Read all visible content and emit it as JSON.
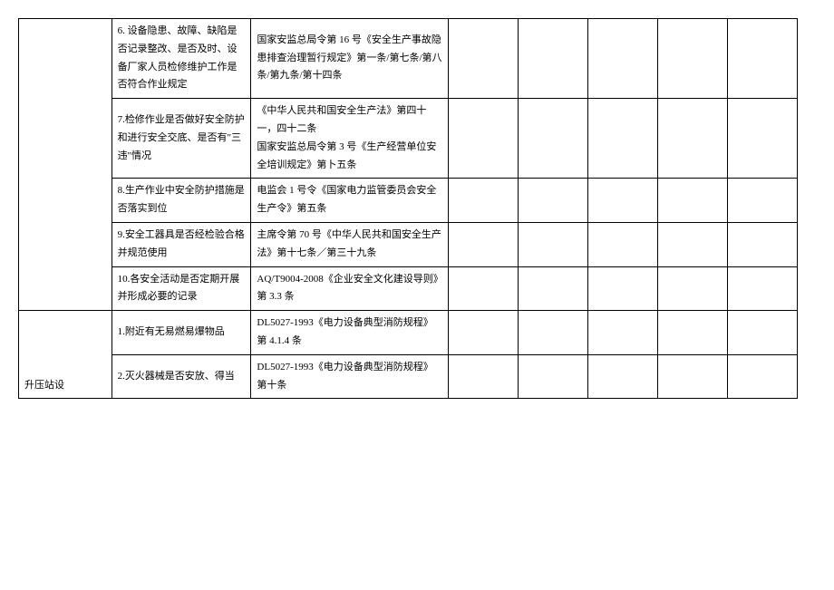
{
  "rows": [
    {
      "col1": "",
      "col2": "6. 设备隐患、故障、缺陷是否记录整改、是否及时、设备厂家人员检修维护工作是否符合作业规定",
      "col3": "国家安监总局令第 16 号《安全生产事故隐患排查治理暂行规定》第一条/第七条/第八条/第九条/第十四条"
    },
    {
      "col1": "",
      "col2": "7.检修作业是否做好安全防护和进行安全交底、是否有\"三违\"情况",
      "col3": "《中华人民共和国安全生产法》第四十一，四十二条\n国家安监总局令第 3 号《生产经营单位安全培训规定》第卜五条"
    },
    {
      "col1": "",
      "col2": "8.生产作业中安全防护措施是否落实到位",
      "col3": "电监会 1 号令《国家电力监管委员会安全生产令》第五条"
    },
    {
      "col1": "",
      "col2": "9.安全工器具是否经检验合格并规范使用",
      "col3": "主席令第 70 号《中华人民共和国安全生产法》第十七条／第三十九条"
    },
    {
      "col1": "",
      "col2": "10.各安全活动是否定期开展并形成必要的记录",
      "col3": "AQ/T9004-2008《企业安全文化建设导则》第 3.3 条"
    },
    {
      "col1": "",
      "col2": "1.附近有无易燃易爆物品",
      "col3": "DL5027-1993《电力设备典型消防规程》第 4.1.4 条"
    },
    {
      "col1": "升压站设",
      "col2": "2.灭火器械是否安放、得当",
      "col3": "DL5027-1993《电力设备典型消防规程》第十条"
    }
  ]
}
